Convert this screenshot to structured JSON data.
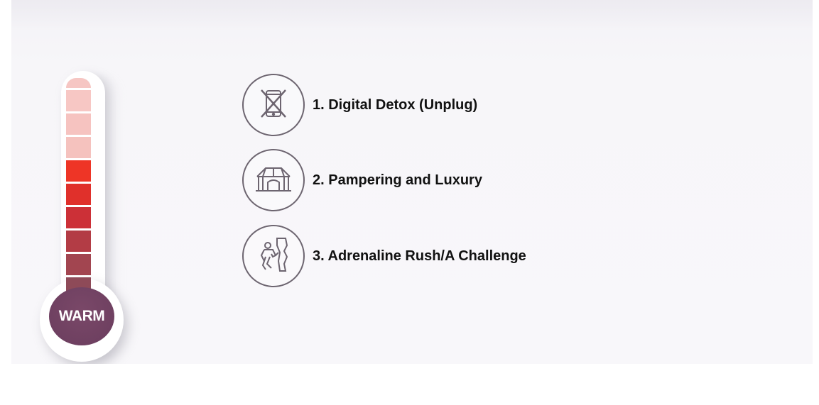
{
  "thermometer": {
    "label": "WARM",
    "segment_colors": [
      "#f6c6c3",
      "#f7c7c4",
      "#f6c3c0",
      "#f5c2be",
      "#ee3526",
      "#e0302b",
      "#cc3037",
      "#b33c45",
      "#a24550",
      "#8e4a58"
    ]
  },
  "items": [
    {
      "label": "1. Digital Detox (Unplug)",
      "icon": "phone-crossed-icon"
    },
    {
      "label": "2. Pampering and Luxury",
      "icon": "tent-icon"
    },
    {
      "label": "3. Adrenaline Rush/A Challenge",
      "icon": "rock-climber-icon"
    }
  ],
  "colors": {
    "icon_stroke": "#6d6570",
    "bulb": "#6a3d5e",
    "text": "#111111"
  }
}
